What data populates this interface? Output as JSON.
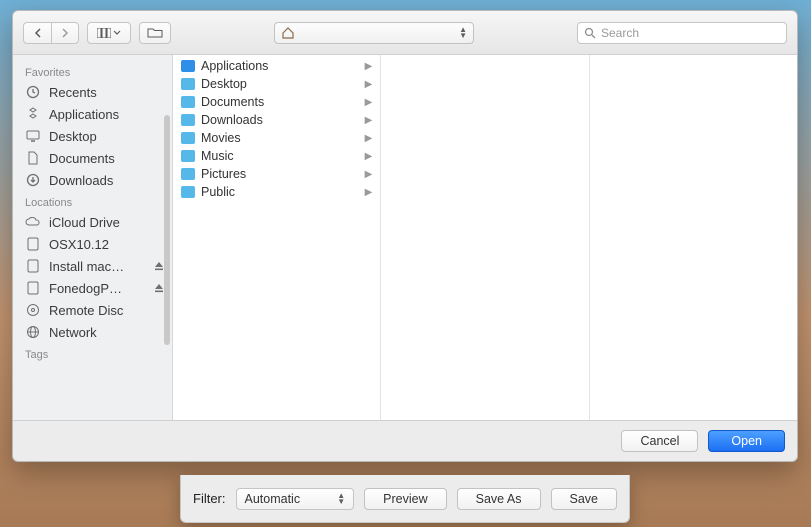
{
  "toolbar": {
    "path_label": "",
    "search_placeholder": "Search"
  },
  "sidebar": {
    "sections": [
      {
        "title": "Favorites",
        "items": [
          {
            "icon": "clock",
            "label": "Recents"
          },
          {
            "icon": "apps",
            "label": "Applications"
          },
          {
            "icon": "desktop",
            "label": "Desktop"
          },
          {
            "icon": "doc",
            "label": "Documents"
          },
          {
            "icon": "download",
            "label": "Downloads"
          }
        ]
      },
      {
        "title": "Locations",
        "items": [
          {
            "icon": "cloud",
            "label": "iCloud Drive"
          },
          {
            "icon": "disk",
            "label": "OSX10.12"
          },
          {
            "icon": "disk",
            "label": "Install mac…",
            "eject": true
          },
          {
            "icon": "disk",
            "label": "FonedogP…",
            "eject": true
          },
          {
            "icon": "disc",
            "label": "Remote Disc"
          },
          {
            "icon": "globe",
            "label": "Network"
          }
        ]
      },
      {
        "title": "Tags",
        "items": []
      }
    ]
  },
  "columns": [
    {
      "items": [
        {
          "label": "Applications",
          "color": "#2f8fe8",
          "arrow": true
        },
        {
          "label": "Desktop",
          "color": "#56b7e9",
          "arrow": true
        },
        {
          "label": "Documents",
          "color": "#56b7e9",
          "arrow": true
        },
        {
          "label": "Downloads",
          "color": "#56b7e9",
          "arrow": true
        },
        {
          "label": "Movies",
          "color": "#56b7e9",
          "arrow": true
        },
        {
          "label": "Music",
          "color": "#56b7e9",
          "arrow": true
        },
        {
          "label": "Pictures",
          "color": "#56b7e9",
          "arrow": true
        },
        {
          "label": "Public",
          "color": "#56b7e9",
          "arrow": true
        }
      ]
    },
    {
      "items": []
    },
    {
      "items": []
    }
  ],
  "footer": {
    "cancel": "Cancel",
    "open": "Open"
  },
  "lower": {
    "filter_label": "Filter:",
    "filter_value": "Automatic",
    "preview": "Preview",
    "saveas": "Save As",
    "save": "Save"
  }
}
